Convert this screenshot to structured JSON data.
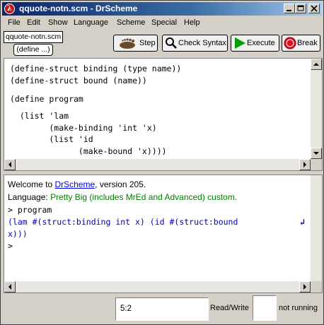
{
  "window": {
    "title": "qquote-notn.scm - DrScheme",
    "app_icon_glyph": "λ"
  },
  "menu": [
    "File",
    "Edit",
    "Show",
    "Language",
    "Scheme",
    "Special",
    "Help"
  ],
  "file_tab": "qquote-notn.scm",
  "define_popup": "(define ...)",
  "toolbar": {
    "step": "Step",
    "check_syntax": "Check Syntax",
    "execute": "Execute",
    "break": "Break"
  },
  "definitions": [
    "(define-struct binding (type name))",
    "(define-struct bound (name))",
    "(define program",
    "  (list 'lam",
    "        (make-binding 'int 'x)",
    "        (list 'id",
    "              (make-bound 'x))))"
  ],
  "interactions": {
    "welcome_prefix": "Welcome to ",
    "welcome_link": "DrScheme",
    "welcome_suffix": ", version 205.",
    "language_prefix": "Language: ",
    "language_value": "Pretty Big (includes MrEd and Advanced) custom.",
    "prompt1": "> program",
    "output1": "(lam #(struct:binding int x) (id #(struct:bound",
    "output2": "x)))",
    "wrap_glyph": "↲",
    "prompt2": ">"
  },
  "status": {
    "position": "5:2",
    "mode": "Read/Write",
    "running": "not running"
  },
  "colors": {
    "title_gradient_start": "#0a246a",
    "output_blue": "#0000c0",
    "language_green": "#008000",
    "execute_green": "#00a000",
    "break_red": "#e01020"
  }
}
